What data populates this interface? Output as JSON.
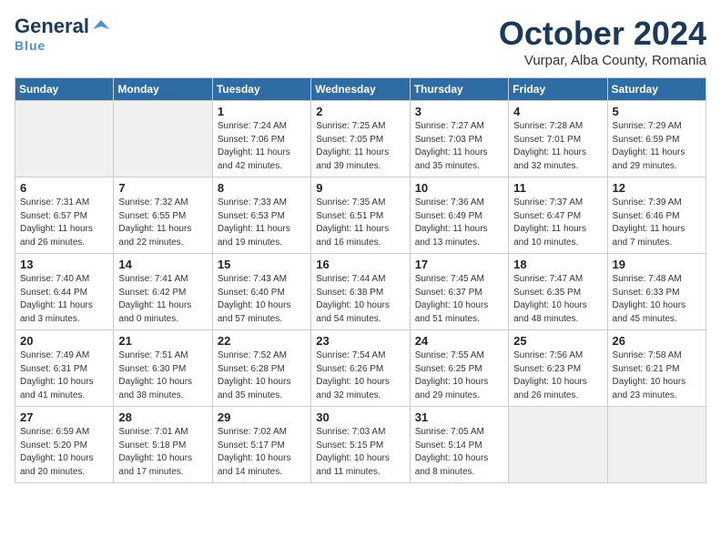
{
  "header": {
    "logo_general": "General",
    "logo_blue": "Blue",
    "logo_sub": "Blue",
    "month": "October 2024",
    "location": "Vurpar, Alba County, Romania"
  },
  "weekdays": [
    "Sunday",
    "Monday",
    "Tuesday",
    "Wednesday",
    "Thursday",
    "Friday",
    "Saturday"
  ],
  "weeks": [
    [
      {
        "day": "",
        "info": ""
      },
      {
        "day": "",
        "info": ""
      },
      {
        "day": "1",
        "info": "Sunrise: 7:24 AM\nSunset: 7:06 PM\nDaylight: 11 hours and 42 minutes."
      },
      {
        "day": "2",
        "info": "Sunrise: 7:25 AM\nSunset: 7:05 PM\nDaylight: 11 hours and 39 minutes."
      },
      {
        "day": "3",
        "info": "Sunrise: 7:27 AM\nSunset: 7:03 PM\nDaylight: 11 hours and 35 minutes."
      },
      {
        "day": "4",
        "info": "Sunrise: 7:28 AM\nSunset: 7:01 PM\nDaylight: 11 hours and 32 minutes."
      },
      {
        "day": "5",
        "info": "Sunrise: 7:29 AM\nSunset: 6:59 PM\nDaylight: 11 hours and 29 minutes."
      }
    ],
    [
      {
        "day": "6",
        "info": "Sunrise: 7:31 AM\nSunset: 6:57 PM\nDaylight: 11 hours and 26 minutes."
      },
      {
        "day": "7",
        "info": "Sunrise: 7:32 AM\nSunset: 6:55 PM\nDaylight: 11 hours and 22 minutes."
      },
      {
        "day": "8",
        "info": "Sunrise: 7:33 AM\nSunset: 6:53 PM\nDaylight: 11 hours and 19 minutes."
      },
      {
        "day": "9",
        "info": "Sunrise: 7:35 AM\nSunset: 6:51 PM\nDaylight: 11 hours and 16 minutes."
      },
      {
        "day": "10",
        "info": "Sunrise: 7:36 AM\nSunset: 6:49 PM\nDaylight: 11 hours and 13 minutes."
      },
      {
        "day": "11",
        "info": "Sunrise: 7:37 AM\nSunset: 6:47 PM\nDaylight: 11 hours and 10 minutes."
      },
      {
        "day": "12",
        "info": "Sunrise: 7:39 AM\nSunset: 6:46 PM\nDaylight: 11 hours and 7 minutes."
      }
    ],
    [
      {
        "day": "13",
        "info": "Sunrise: 7:40 AM\nSunset: 6:44 PM\nDaylight: 11 hours and 3 minutes."
      },
      {
        "day": "14",
        "info": "Sunrise: 7:41 AM\nSunset: 6:42 PM\nDaylight: 11 hours and 0 minutes."
      },
      {
        "day": "15",
        "info": "Sunrise: 7:43 AM\nSunset: 6:40 PM\nDaylight: 10 hours and 57 minutes."
      },
      {
        "day": "16",
        "info": "Sunrise: 7:44 AM\nSunset: 6:38 PM\nDaylight: 10 hours and 54 minutes."
      },
      {
        "day": "17",
        "info": "Sunrise: 7:45 AM\nSunset: 6:37 PM\nDaylight: 10 hours and 51 minutes."
      },
      {
        "day": "18",
        "info": "Sunrise: 7:47 AM\nSunset: 6:35 PM\nDaylight: 10 hours and 48 minutes."
      },
      {
        "day": "19",
        "info": "Sunrise: 7:48 AM\nSunset: 6:33 PM\nDaylight: 10 hours and 45 minutes."
      }
    ],
    [
      {
        "day": "20",
        "info": "Sunrise: 7:49 AM\nSunset: 6:31 PM\nDaylight: 10 hours and 41 minutes."
      },
      {
        "day": "21",
        "info": "Sunrise: 7:51 AM\nSunset: 6:30 PM\nDaylight: 10 hours and 38 minutes."
      },
      {
        "day": "22",
        "info": "Sunrise: 7:52 AM\nSunset: 6:28 PM\nDaylight: 10 hours and 35 minutes."
      },
      {
        "day": "23",
        "info": "Sunrise: 7:54 AM\nSunset: 6:26 PM\nDaylight: 10 hours and 32 minutes."
      },
      {
        "day": "24",
        "info": "Sunrise: 7:55 AM\nSunset: 6:25 PM\nDaylight: 10 hours and 29 minutes."
      },
      {
        "day": "25",
        "info": "Sunrise: 7:56 AM\nSunset: 6:23 PM\nDaylight: 10 hours and 26 minutes."
      },
      {
        "day": "26",
        "info": "Sunrise: 7:58 AM\nSunset: 6:21 PM\nDaylight: 10 hours and 23 minutes."
      }
    ],
    [
      {
        "day": "27",
        "info": "Sunrise: 6:59 AM\nSunset: 5:20 PM\nDaylight: 10 hours and 20 minutes."
      },
      {
        "day": "28",
        "info": "Sunrise: 7:01 AM\nSunset: 5:18 PM\nDaylight: 10 hours and 17 minutes."
      },
      {
        "day": "29",
        "info": "Sunrise: 7:02 AM\nSunset: 5:17 PM\nDaylight: 10 hours and 14 minutes."
      },
      {
        "day": "30",
        "info": "Sunrise: 7:03 AM\nSunset: 5:15 PM\nDaylight: 10 hours and 11 minutes."
      },
      {
        "day": "31",
        "info": "Sunrise: 7:05 AM\nSunset: 5:14 PM\nDaylight: 10 hours and 8 minutes."
      },
      {
        "day": "",
        "info": ""
      },
      {
        "day": "",
        "info": ""
      }
    ]
  ]
}
